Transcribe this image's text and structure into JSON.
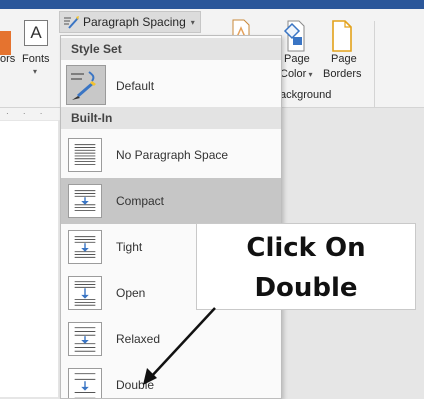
{
  "ribbon": {
    "fonts_label": "Fonts",
    "colors_label": "ors",
    "theme_letter": "A",
    "page_color_label_1": "Page",
    "page_color_label_2": "Color",
    "page_borders_label_1": "Page",
    "page_borders_label_2": "Borders",
    "group_background_label": "ackground",
    "paragraph_spacing_button": "Paragraph Spacing",
    "ruler_marks": "· · · ·"
  },
  "dropdown": {
    "style_set_header": "Style Set",
    "default_label": "Default",
    "builtin_header": "Built-In",
    "items": [
      {
        "label": "No Paragraph Space",
        "icon": "no-spacing-icon"
      },
      {
        "label": "Compact",
        "icon": "compact-spacing-icon",
        "selected": true
      },
      {
        "label": "Tight",
        "icon": "tight-spacing-icon"
      },
      {
        "label": "Open",
        "icon": "open-spacing-icon"
      },
      {
        "label": "Relaxed",
        "icon": "relaxed-spacing-icon"
      },
      {
        "label": "Double",
        "icon": "double-spacing-icon"
      }
    ]
  },
  "callout": {
    "line1": "Click On",
    "line2": "Double"
  },
  "colors": {
    "titlebar": "#2b579a",
    "selected_item": "#c6c6c6",
    "accent_blue": "#3a75c4",
    "orange": "#e5732f"
  }
}
